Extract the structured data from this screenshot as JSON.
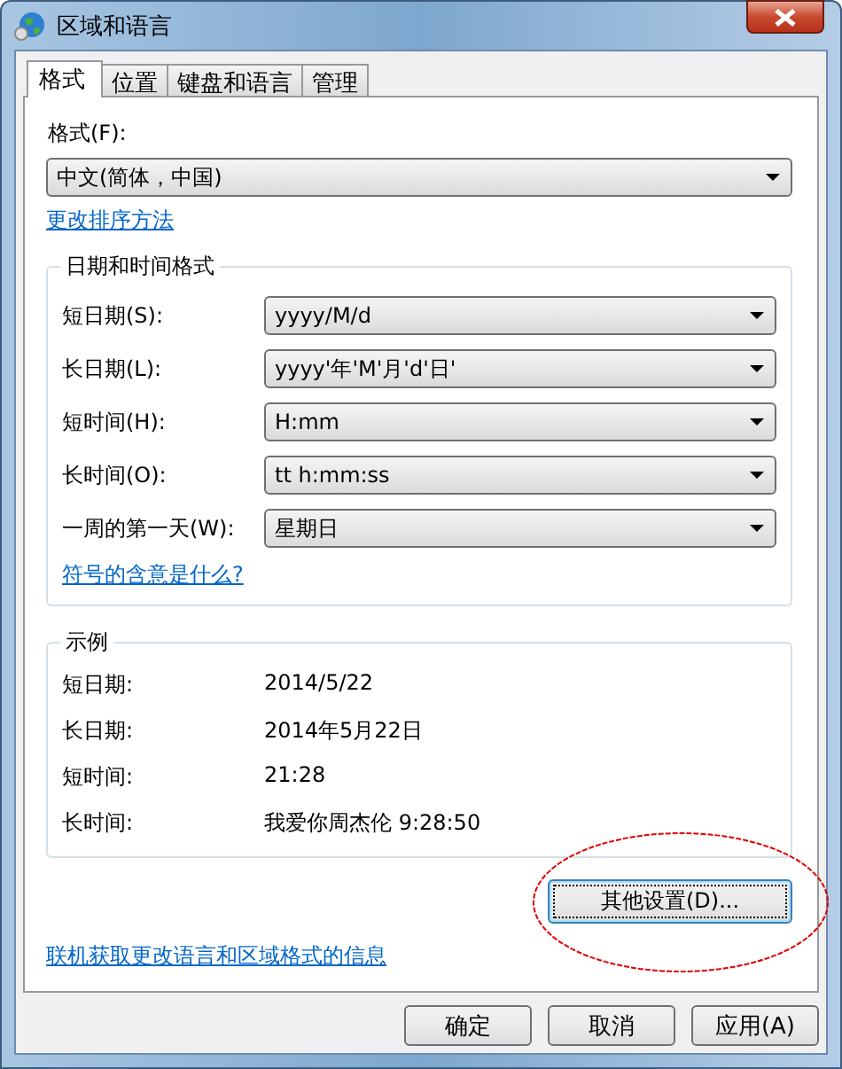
{
  "window": {
    "title": "区域和语言"
  },
  "tabs": [
    {
      "label": "格式",
      "selected": true
    },
    {
      "label": "位置",
      "selected": false
    },
    {
      "label": "键盘和语言",
      "selected": false
    },
    {
      "label": "管理",
      "selected": false
    }
  ],
  "format": {
    "label": "格式(F):",
    "value": "中文(简体，中国)"
  },
  "sort_link": "更改排序方法",
  "datetime_group": {
    "title": "日期和时间格式",
    "fields": [
      {
        "label": "短日期(S):",
        "value": "yyyy/M/d"
      },
      {
        "label": "长日期(L):",
        "value": "yyyy'年'M'月'd'日'"
      },
      {
        "label": "短时间(H):",
        "value": "H:mm"
      },
      {
        "label": "长时间(O):",
        "value": "tt h:mm:ss"
      },
      {
        "label": "一周的第一天(W):",
        "value": "星期日"
      }
    ],
    "link": "符号的含意是什么?"
  },
  "examples": {
    "title": "示例",
    "rows": [
      {
        "label": "短日期:",
        "value": "2014/5/22"
      },
      {
        "label": "长日期:",
        "value": "2014年5月22日"
      },
      {
        "label": "短时间:",
        "value": "21:28"
      },
      {
        "label": "长时间:",
        "value": "我爱你周杰伦 9:28:50"
      }
    ]
  },
  "additional_settings_button": {
    "label": "其他设置(D)...",
    "focused": true
  },
  "annotation": {
    "kind": "ellipse",
    "color": "#e00000"
  },
  "online_link": "联机获取更改语言和区域格式的信息",
  "buttons": [
    {
      "label": "确定"
    },
    {
      "label": "取消"
    },
    {
      "label": "应用(A)"
    }
  ]
}
